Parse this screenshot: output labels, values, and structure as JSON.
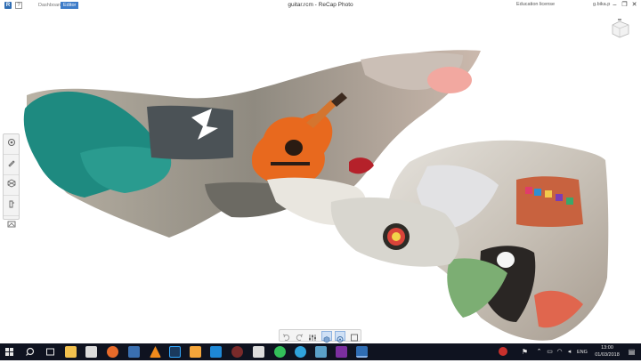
{
  "titlebar": {
    "logo": "R",
    "help": "?",
    "tab_dashboard": "Dashboard",
    "tab_editor": "Editor",
    "title": "guitar.rcm - ReCap Photo",
    "license": "Education license",
    "user": "g.bika.p"
  },
  "icons": {
    "palette": [
      "settings-icon",
      "pencil-icon",
      "hexagon-icon",
      "measure-icon",
      "image-frame-icon"
    ],
    "bottom_toolbar": [
      "undo-icon",
      "redo-icon",
      "sliders-icon",
      "cube-icon",
      "orbit-icon",
      "crop-icon"
    ]
  },
  "taskbar": {
    "time": "13:00",
    "date": "01/03/2018",
    "language": "ENG"
  },
  "colors": {
    "taskbar": "#0f1320",
    "editor_tab": "#3d7cc9",
    "logo": "#2f6db3"
  }
}
